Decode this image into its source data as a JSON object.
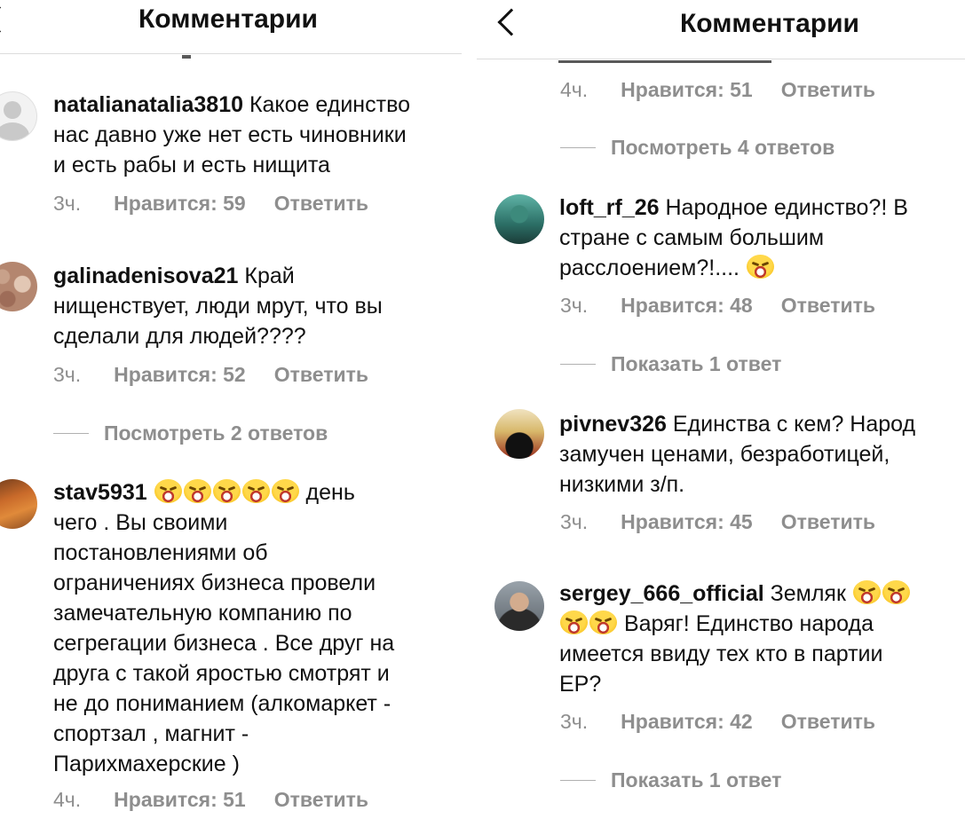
{
  "left": {
    "title": "Комментарии",
    "comments": [
      {
        "username": "natalianatalia3810",
        "lines": [
          " Какое единство",
          "нас давно уже нет есть чиновники",
          "и есть рабы и есть нищита"
        ],
        "time": "3ч.",
        "likes": "Нравится: 59",
        "reply": "Ответить"
      },
      {
        "username": "galinadenisova21",
        "lines": [
          " Край",
          "нищенствует, люди мрут, что вы",
          "сделали для людей????"
        ],
        "time": "3ч.",
        "likes": "Нравится: 52",
        "reply": "Ответить",
        "view_replies": "Посмотреть 2 ответов"
      },
      {
        "username": "stav5931",
        "first_line_suffix": " день",
        "lines": [
          "чего . Вы своими",
          "постановлениями об",
          "ограничениях бизнеса провели",
          "замечательную компанию по",
          "сегрегации бизнеса . Все друг на",
          "друга с такой яростью смотрят и",
          "не до пониманием (алкомаркет -",
          "спортзал , магнит -",
          "Парихмахерские )"
        ],
        "time": "4ч.",
        "likes": "Нравится: 51",
        "reply": "Ответить"
      }
    ]
  },
  "right": {
    "title": "Комментарии",
    "top_meta": {
      "time": "4ч.",
      "likes": "Нравится: 51",
      "reply": "Ответить"
    },
    "top_view_replies": "Посмотреть 4 ответов",
    "comments": [
      {
        "username": "loft_rf_26",
        "lines": [
          " Народное единство?! В",
          "стране с самым большим",
          "расслоением?!.... "
        ],
        "time": "3ч.",
        "likes": "Нравится: 48",
        "reply": "Ответить",
        "view_replies": "Показать 1 ответ"
      },
      {
        "username": "pivnev326",
        "lines": [
          " Единства с кем? Народ",
          "замучен ценами, безработицей,",
          "низкими з/п."
        ],
        "time": "3ч.",
        "likes": "Нравится: 45",
        "reply": "Ответить"
      },
      {
        "username": "sergey_666_official",
        "lines": [
          " Земляк ",
          " Варяг! Единство народа",
          "имеется ввиду тех кто в партии",
          "ЕР?"
        ],
        "time": "3ч.",
        "likes": "Нравится: 42",
        "reply": "Ответить",
        "view_replies": "Показать 1 ответ"
      }
    ]
  },
  "icons": {
    "back": "chevron-left-icon",
    "emoji": "face-with-tears-of-joy-icon",
    "default_avatar": "default-user-avatar-icon"
  }
}
